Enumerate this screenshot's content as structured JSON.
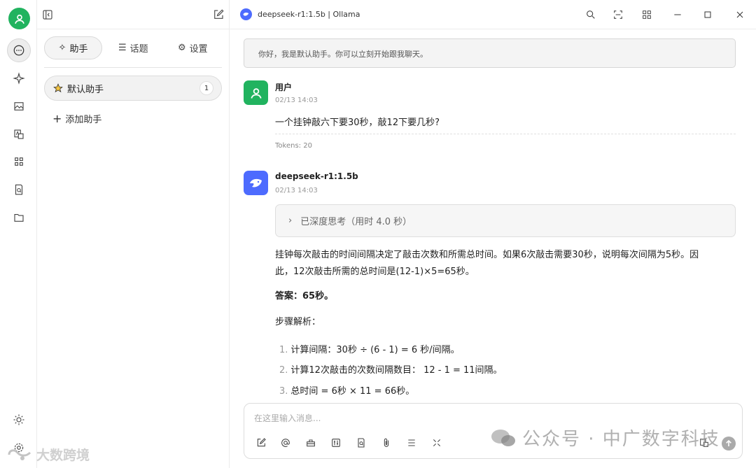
{
  "window": {
    "title": "deepseek-r1:1.5b | Ollama"
  },
  "panel": {
    "tabs": [
      {
        "label": "助手",
        "icon": "sparkle-icon"
      },
      {
        "label": "话题",
        "icon": "list-icon"
      },
      {
        "label": "设置",
        "icon": "gear-icon"
      }
    ],
    "assistant": {
      "name": "默认助手",
      "count": "1",
      "icon": "star-icon"
    },
    "add_label": "添加助手"
  },
  "chat": {
    "welcome": "你好，我是默认助手。你可以立刻开始跟我聊天。",
    "user": {
      "name": "用户",
      "time": "02/13 14:03",
      "text": "一个挂钟敲六下要30秒，敲12下要几秒?",
      "tokens": "Tokens: 20"
    },
    "bot": {
      "name": "deepseek-r1:1.5b",
      "time": "02/13 14:03",
      "think": "已深度思考（用时 4.0 秒）",
      "para1_line1": "挂钟每次敲击的时间间隔决定了敲击次数和所需总时间。如果6次敲击需要30秒，说明每次间隔为5秒。因",
      "para1_line2": "此，12次敲击所需的总时间是(12-1)×5=65秒。",
      "answer": "答案：65秒。",
      "steps_title": "步骤解析：",
      "steps": [
        {
          "num": "1.",
          "text": "计算间隔：30秒 ÷ (6 - 1) = 6 秒/间隔。"
        },
        {
          "num": "2.",
          "text": "计算12次敲击的次数间隔数目： 12 - 1 = 11间隔。"
        },
        {
          "num": "3.",
          "text": "总时间 = 6秒 × 11 = 66秒。"
        }
      ]
    }
  },
  "input": {
    "placeholder": "在这里输入消息..."
  },
  "watermarks": {
    "right": "公众号 · 中广数字科技",
    "left": "大数跨境"
  },
  "colors": {
    "green": "#21b35f",
    "deepseek_blue": "#4d6bfe"
  }
}
